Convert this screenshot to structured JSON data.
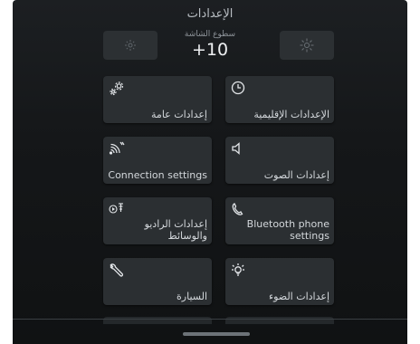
{
  "header": {
    "title": "الإعدادات"
  },
  "brightness": {
    "label": "سطوع الشاشة",
    "value": "+10",
    "decrease_icon": "sun-dim-icon",
    "increase_icon": "sun-bright-icon"
  },
  "tiles": [
    {
      "label": "إعدادات عامة",
      "icon": "gears-icon"
    },
    {
      "label": "الإعدادات الإقليمية",
      "icon": "clock-icon"
    },
    {
      "label": "Connection settings",
      "icon": "connection-icon"
    },
    {
      "label": "إعدادات الصوت",
      "icon": "speaker-icon"
    },
    {
      "label": "إعدادات الراديو والوسائط",
      "icon": "radio-media-icon"
    },
    {
      "label": "Bluetooth phone settings",
      "icon": "phone-icon"
    },
    {
      "label": "السيارة",
      "icon": "wrench-icon"
    },
    {
      "label": "إعدادات الضوء",
      "icon": "light-icon"
    }
  ],
  "colors": {
    "background": "#151719",
    "tile": "#2b2f32",
    "text": "#d4d8dc"
  }
}
